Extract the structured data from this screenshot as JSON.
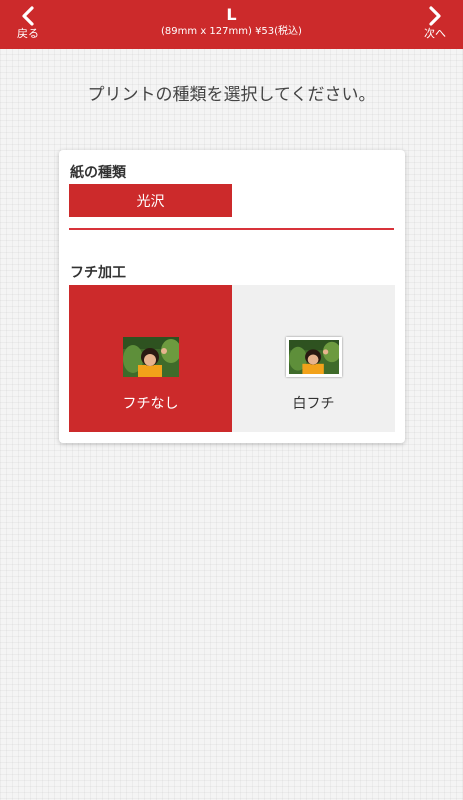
{
  "header": {
    "back_label": "戻る",
    "next_label": "次へ",
    "title": "L",
    "subtitle": "(89mm x 127mm) ¥53(税込)",
    "accent_color": "#cc2a2b"
  },
  "instruction": "プリントの種類を選択してください。",
  "paper": {
    "label": "紙の種類",
    "options": [
      {
        "label": "光沢",
        "selected": true
      }
    ]
  },
  "border": {
    "label": "フチ加工",
    "options": [
      {
        "label": "フチなし",
        "selected": true,
        "icon": "photo-thumbnail-borderless"
      },
      {
        "label": "白フチ",
        "selected": false,
        "icon": "photo-thumbnail-white-border"
      }
    ]
  }
}
